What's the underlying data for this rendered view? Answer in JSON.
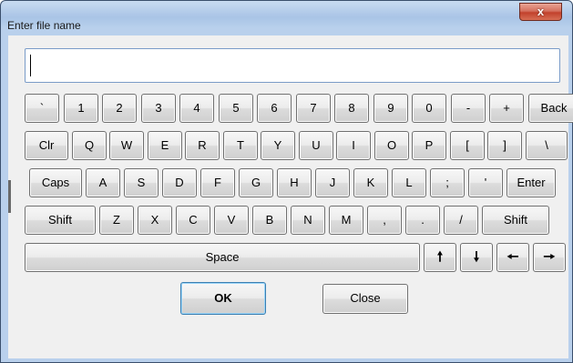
{
  "window": {
    "title": "Enter file name",
    "close_glyph": "x"
  },
  "input": {
    "value": ""
  },
  "rows": [
    [
      "`",
      "1",
      "2",
      "3",
      "4",
      "5",
      "6",
      "7",
      "8",
      "9",
      "0",
      "-",
      "+",
      "Back"
    ],
    [
      "Clr",
      "Q",
      "W",
      "E",
      "R",
      "T",
      "Y",
      "U",
      "I",
      "O",
      "P",
      "[",
      "]",
      "\\"
    ],
    [
      "Caps",
      "A",
      "S",
      "D",
      "F",
      "G",
      "H",
      "J",
      "K",
      "L",
      ";",
      "'",
      "Enter"
    ],
    [
      "Shift",
      "Z",
      "X",
      "C",
      "V",
      "B",
      "N",
      "M",
      ",",
      ".",
      "/",
      "Shift"
    ]
  ],
  "bottom_row": {
    "space": "Space",
    "arrows": [
      {
        "glyph": "🠕",
        "icon": "arrow-up-icon"
      },
      {
        "glyph": "🠗",
        "icon": "arrow-down-icon"
      },
      {
        "glyph": "🠔",
        "icon": "arrow-left-icon"
      },
      {
        "glyph": "🠖",
        "icon": "arrow-right-icon"
      }
    ]
  },
  "buttons": {
    "ok": "OK",
    "close": "Close"
  },
  "colors": {
    "titlebar": "#b9d0ec",
    "close_button": "#c2412c",
    "ok_border": "#3c7fb1",
    "client_bg": "#f0f0f0"
  }
}
